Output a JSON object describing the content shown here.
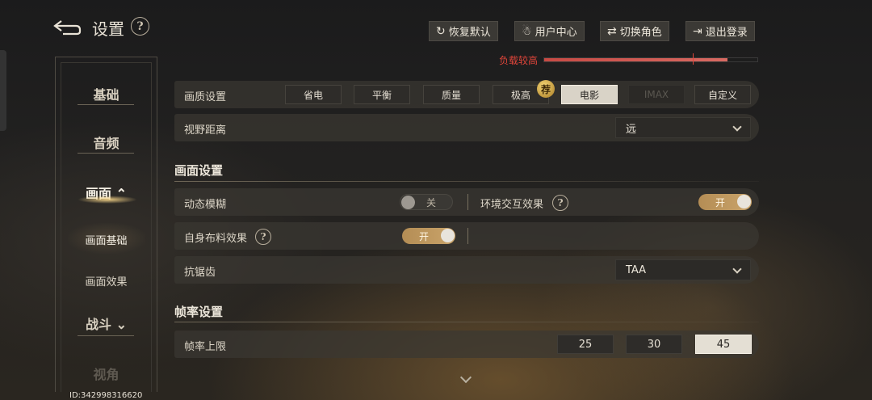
{
  "header": {
    "title": "设置",
    "help_glyph": "?",
    "buttons": [
      {
        "label": "恢复默认",
        "icon": "restore-icon",
        "glyph": "↻"
      },
      {
        "label": "用户中心",
        "icon": "user-center-icon",
        "glyph": "☃"
      },
      {
        "label": "切换角色",
        "icon": "switch-icon",
        "glyph": "⇄"
      },
      {
        "label": "退出登录",
        "icon": "logout-icon",
        "glyph": "⇥"
      }
    ]
  },
  "load": {
    "label": "负载较高",
    "level": 0.86,
    "color": "#e0453a"
  },
  "sidebar": {
    "items": [
      {
        "label": "基础"
      },
      {
        "label": "音频"
      },
      {
        "label": "画面",
        "arrow": "⌃"
      },
      {
        "label": "画面基础"
      },
      {
        "label": "画面效果"
      },
      {
        "label": "战斗",
        "arrow": "⌄"
      },
      {
        "label": "视角"
      }
    ]
  },
  "quality": {
    "label": "画质设置",
    "options": [
      "省电",
      "平衡",
      "质量",
      "极高",
      "电影",
      "IMAX",
      "自定义"
    ],
    "selected": "电影",
    "disabled": "IMAX",
    "recommend_badge": "荐"
  },
  "view_distance": {
    "label": "视野距离",
    "value": "远"
  },
  "section_picture": {
    "title": "画面设置"
  },
  "motion_blur": {
    "label": "动态模糊",
    "state": "关"
  },
  "env_interaction": {
    "label": "环境交互效果",
    "state": "开"
  },
  "cloth": {
    "label": "自身布料效果",
    "state": "开"
  },
  "antialias": {
    "label": "抗锯齿",
    "value": "TAA"
  },
  "section_fps": {
    "title": "帧率设置"
  },
  "fps": {
    "label": "帧率上限",
    "options": [
      "25",
      "30",
      "45"
    ],
    "selected": "45"
  },
  "footer": {
    "id_text": "ID:342998316620"
  }
}
